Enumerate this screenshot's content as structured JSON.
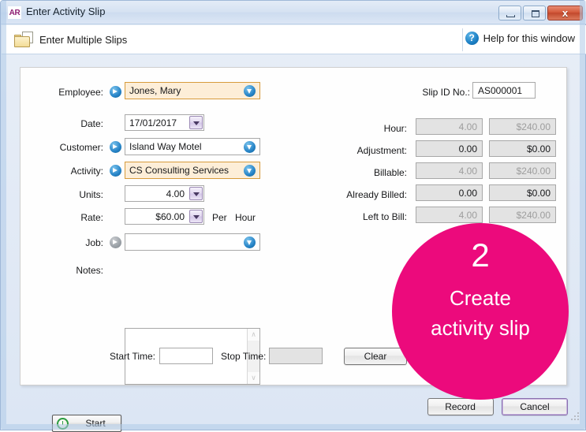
{
  "window": {
    "app_icon_text": "AR",
    "title": "Enter Activity Slip",
    "minimize_label": "–",
    "maximize_label": "□",
    "close_label": "x"
  },
  "toolbar": {
    "multiple_slips_label": "Enter Multiple Slips",
    "help_icon_glyph": "?",
    "help_label": "Help for this window"
  },
  "form": {
    "employee": {
      "label": "Employee:",
      "value": "Jones, Mary"
    },
    "slip_id": {
      "label": "Slip ID No.:",
      "value": "AS000001"
    },
    "date": {
      "label": "Date:",
      "value": "17/01/2017"
    },
    "customer": {
      "label": "Customer:",
      "value": "Island Way Motel"
    },
    "activity": {
      "label": "Activity:",
      "value": "CS Consulting Services"
    },
    "units": {
      "label": "Units:",
      "value": "4.00"
    },
    "rate": {
      "label": "Rate:",
      "value": "$60.00",
      "per_label": "Per",
      "unit_label": "Hour"
    },
    "job": {
      "label": "Job:",
      "value": ""
    },
    "notes": {
      "label": "Notes:",
      "value": ""
    },
    "hour": {
      "label": "Hour:",
      "qty": "4.00",
      "amount": "$240.00"
    },
    "adjustment": {
      "label": "Adjustment:",
      "qty": "0.00",
      "amount": "$0.00"
    },
    "billable": {
      "label": "Billable:",
      "qty": "4.00",
      "amount": "$240.00"
    },
    "already_billed": {
      "label": "Already Billed:",
      "qty": "0.00",
      "amount": "$0.00"
    },
    "left_to_bill": {
      "label": "Left to Bill:",
      "qty": "4.00",
      "amount": "$240.00"
    }
  },
  "timer": {
    "start_button": "Start",
    "start_time_label": "Start Time:",
    "start_time_value": "",
    "stop_time_label": "Stop Time:",
    "stop_time_value": "",
    "clear_button": "Clear"
  },
  "footer": {
    "record_button": "Record",
    "cancel_button": "Cancel"
  },
  "callout": {
    "number": "2",
    "line1": "Create",
    "line2": "activity slip",
    "color": "#ec0a7c"
  },
  "scrollbar": {
    "up_glyph": "∧",
    "down_glyph": "∨"
  }
}
